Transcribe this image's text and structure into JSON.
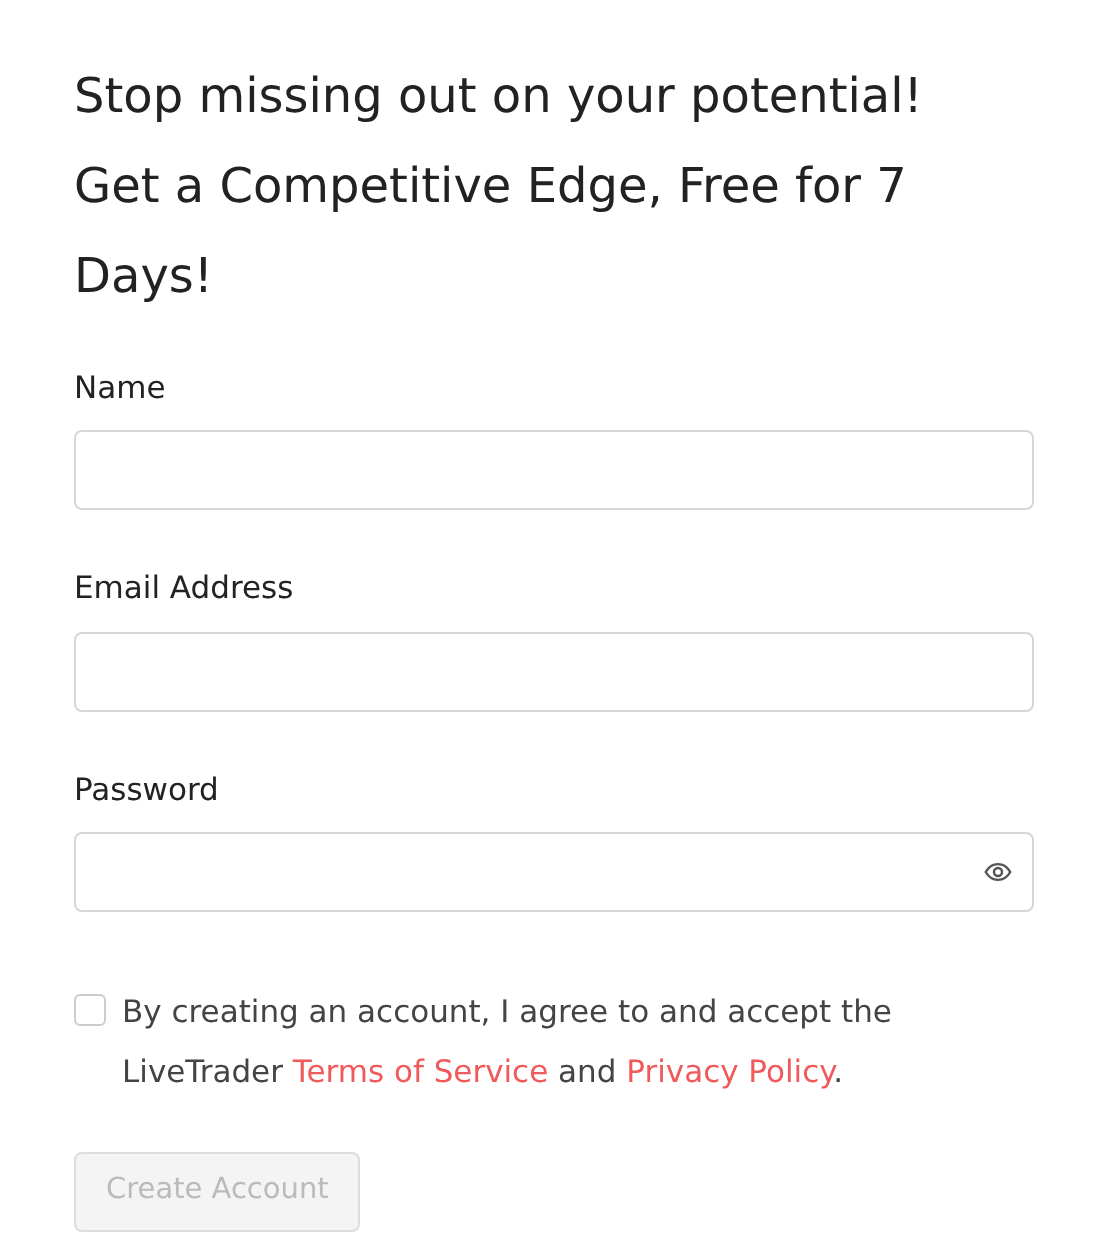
{
  "heading": [
    "Stop missing out on your potential!",
    "Get a Competitive Edge, Free for 7 Days!"
  ],
  "fields": [
    {
      "label": "Name",
      "kind": "text"
    },
    {
      "label": "Email Address",
      "kind": "text"
    },
    {
      "label": "Password",
      "kind": "password"
    }
  ],
  "agreement": {
    "checked": false,
    "parts": [
      {
        "kind": "text",
        "text": "By creating an account, I agree to and accept the LiveTrader "
      },
      {
        "kind": "link",
        "text": "Terms of Service"
      },
      {
        "kind": "text",
        "text": " and "
      },
      {
        "kind": "link",
        "text": "Privacy Policy"
      },
      {
        "kind": "text",
        "text": "."
      }
    ]
  },
  "submit": {
    "label": "Create Account",
    "disabled": true
  }
}
